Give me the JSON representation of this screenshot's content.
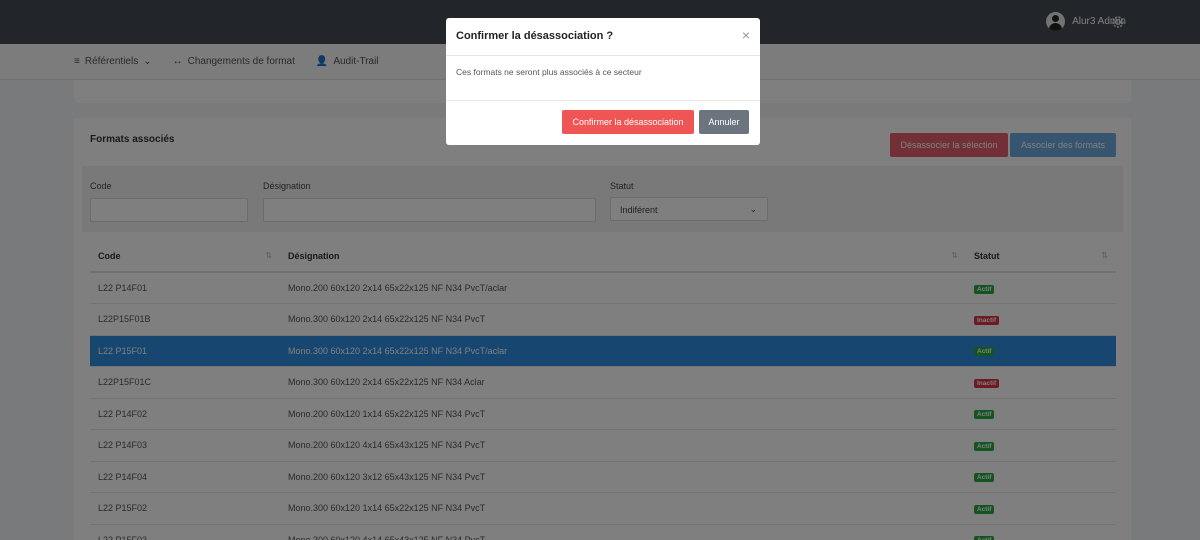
{
  "header": {
    "user_name": "Alur3 Admin"
  },
  "nav": {
    "referentiels": "Référentiels",
    "changements": "Changements de format",
    "audit": "Audit-Trail"
  },
  "card": {
    "title": "Formats associés",
    "dissociate_label": "Désassocier la sélection",
    "associate_label": "Associer des formats"
  },
  "filters": {
    "code_label": "Code",
    "designation_label": "Désignation",
    "statut_label": "Statut",
    "statut_value": "Indiférent"
  },
  "table": {
    "headers": {
      "code": "Code",
      "designation": "Désignation",
      "statut": "Statut"
    },
    "rows": [
      {
        "code": "L22 P14F01",
        "designation": "Mono.200 60x120 2x14 65x22x125 NF N34 PvcT/aclar",
        "statut": "Actif",
        "statut_color": "#28a745",
        "selected": false
      },
      {
        "code": "L22P15F01B",
        "designation": "Mono.300 60x120 2x14 65x22x125 NF N34 PvcT",
        "statut": "Inactif",
        "statut_color": "#dc3545",
        "selected": false
      },
      {
        "code": "L22 P15F01",
        "designation": "Mono.300 60x120 2x14 65x22x125 NF N34 PvcT/aclar",
        "statut": "Actif",
        "statut_color": "#28a745",
        "selected": true
      },
      {
        "code": "L22P15F01C",
        "designation": "Mono.300 60x120 2x14 65x22x125 NF N34 Aclar",
        "statut": "Inactif",
        "statut_color": "#dc3545",
        "selected": false
      },
      {
        "code": "L22 P14F02",
        "designation": "Mono.200 60x120 1x14 65x22x125 NF N34 PvcT",
        "statut": "Actif",
        "statut_color": "#28a745",
        "selected": false
      },
      {
        "code": "L22 P14F03",
        "designation": "Mono.200 60x120 4x14 65x43x125 NF N34 PvcT",
        "statut": "Actif",
        "statut_color": "#28a745",
        "selected": false
      },
      {
        "code": "L22 P14F04",
        "designation": "Mono.200 60x120 3x12 65x43x125 NF N34 PvcT",
        "statut": "Actif",
        "statut_color": "#28a745",
        "selected": false
      },
      {
        "code": "L22 P15F02",
        "designation": "Mono.300 60x120 1x14 65x22x125 NF N34 PvcT",
        "statut": "Actif",
        "statut_color": "#28a745",
        "selected": false
      },
      {
        "code": "L22 P15F03",
        "designation": "Mono.300 60x120 4x14 65x43x125 NF N34 PvcT",
        "statut": "Actif",
        "statut_color": "#28a745",
        "selected": false
      }
    ]
  },
  "modal": {
    "title": "Confirmer la désassociation ?",
    "close_glyph": "×",
    "message": "Ces formats ne seront plus associés à ce secteur",
    "confirm_label": "Confirmer la désassociation",
    "cancel_label": "Annuler"
  }
}
